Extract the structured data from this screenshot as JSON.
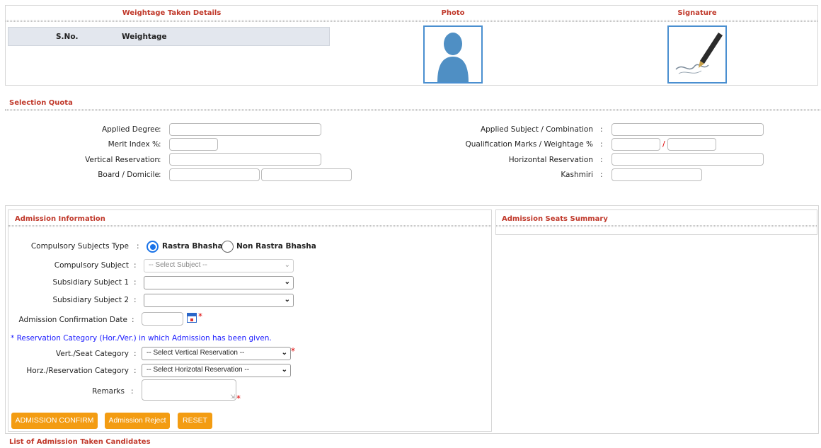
{
  "top": {
    "weightage_header": "Weightage Taken Details",
    "photo_header": "Photo",
    "signature_header": "Signature",
    "table": {
      "col_sno": "S.No.",
      "col_weightage": "Weightage"
    }
  },
  "selection": {
    "title": "Selection Quota",
    "applied_degree": "Applied Degree",
    "merit_index": "Merit Index %",
    "vertical_reservation": "Vertical Reservation",
    "board_domicile": "Board / Domicile",
    "applied_subject": "Applied Subject / Combination",
    "qualification_marks": "Qualification Marks / Weightage %",
    "horizontal_reservation": "Horizontal Reservation",
    "kashmiri": "Kashmiri",
    "colon": ":",
    "slash": "/"
  },
  "admission": {
    "title": "Admission Information",
    "compulsory_type_label": "Compulsory Subjects Type",
    "radio_rastra": "Rastra Bhasha",
    "radio_non_rastra": "Non Rastra Bhasha",
    "compulsory_subject_label": "Compulsory Subject",
    "compulsory_subject_value": "-- Select Subject --",
    "subsidiary1_label": "Subsidiary Subject 1",
    "subsidiary2_label": "Subsidiary Subject 2",
    "confirm_date_label": "Admission Confirmation Date",
    "reservation_note": "* Reservation Category (Hor./Ver.) in which Admission has been given.",
    "vert_label": "Vert./Seat Category",
    "vert_value": "-- Select Vertical Reservation --",
    "horz_label": "Horz./Reservation Category",
    "horz_value": "-- Select Horizotal Reservation --",
    "remarks_label": "Remarks",
    "star": "*",
    "btn_confirm": "ADMISSION CONFIRM",
    "btn_reject": "Admission Reject",
    "btn_reset": "RESET"
  },
  "summary": {
    "title": "Admission Seats Summary"
  },
  "footer": {
    "list_title": "List of Admission Taken Candidates"
  },
  "colors": {
    "accent": "#f39c12",
    "header_red": "#c0392b",
    "link_blue": "#1a1aff"
  }
}
